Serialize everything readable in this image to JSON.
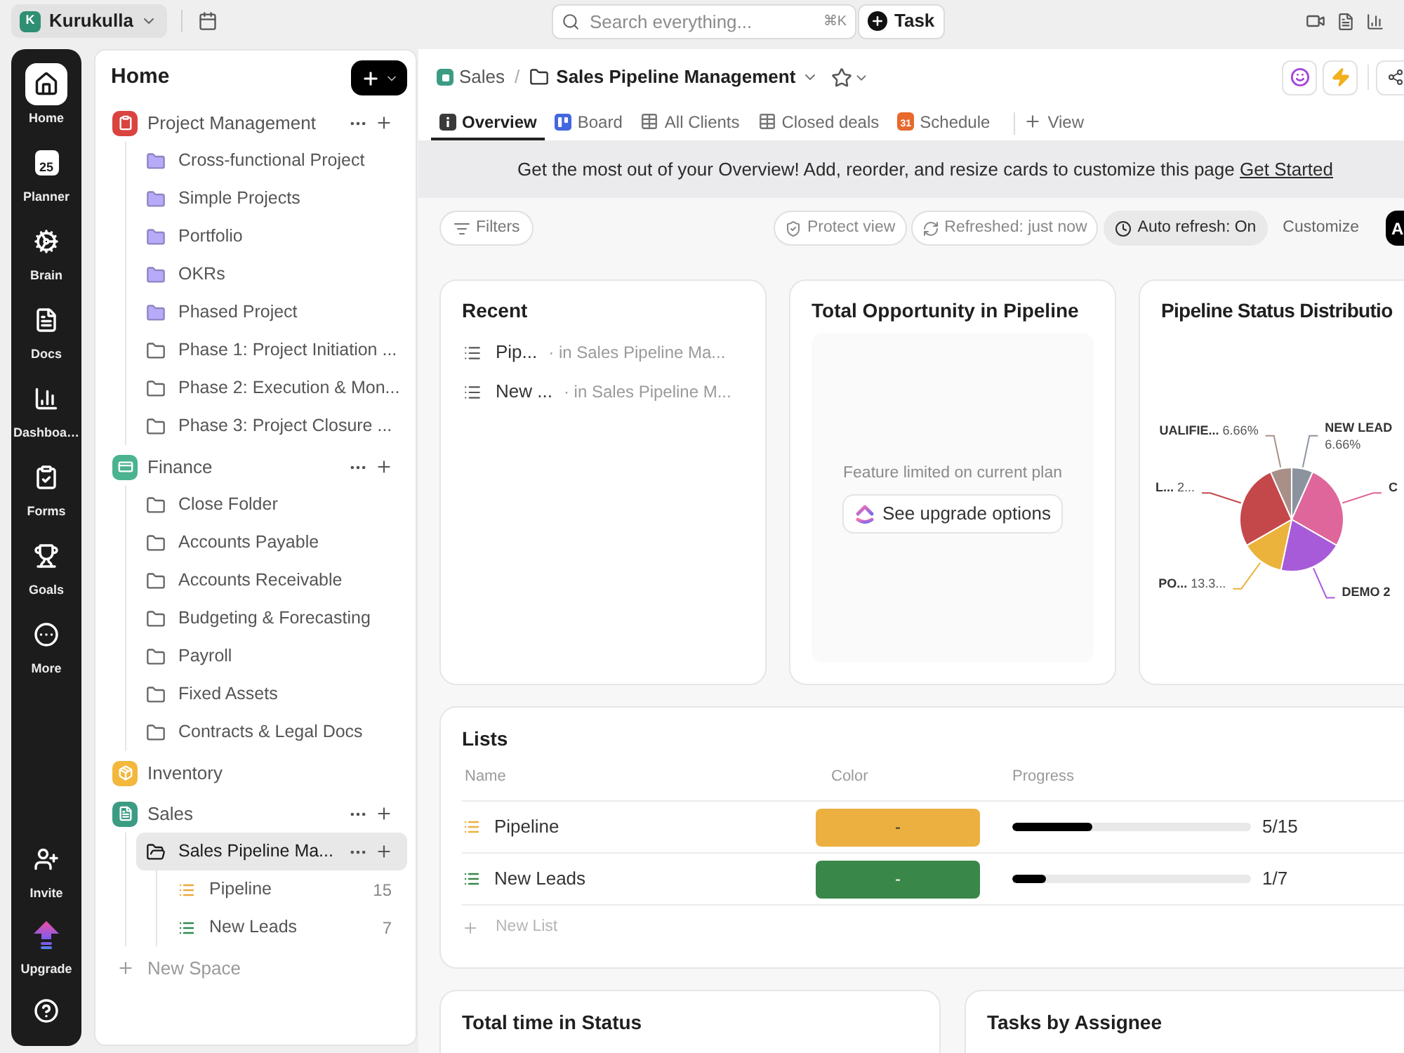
{
  "top_bar": {
    "workspace": {
      "avatar_letter": "K",
      "name": "Kurukulla"
    },
    "search": {
      "placeholder": "Search everything...",
      "shortcut": "⌘K"
    },
    "task_button": "Task"
  },
  "rail": {
    "items": [
      {
        "kind": "home",
        "label": "Home",
        "selected": true
      },
      {
        "kind": "planner",
        "label": "Planner",
        "icon_text": "25",
        "selected": false
      },
      {
        "kind": "brain",
        "label": "Brain",
        "selected": false
      },
      {
        "kind": "docs",
        "label": "Docs",
        "selected": false
      },
      {
        "kind": "dashboards",
        "label": "Dashboa…",
        "selected": false
      },
      {
        "kind": "forms",
        "label": "Forms",
        "selected": false
      },
      {
        "kind": "goals",
        "label": "Goals",
        "selected": false
      },
      {
        "kind": "more",
        "label": "More",
        "selected": false
      }
    ],
    "bottom_items": [
      {
        "kind": "invite",
        "label": "Invite"
      },
      {
        "kind": "upgrade",
        "label": "Upgrade"
      },
      {
        "kind": "help"
      }
    ]
  },
  "sidebar": {
    "title": "Home",
    "spaces": [
      {
        "name": "Project Management",
        "kind": "clipboard",
        "color": "#d9443f",
        "actions": true,
        "children": [
          {
            "name": "Cross-functional Project",
            "color": "#b7abf9",
            "selected": false
          },
          {
            "name": "Simple Projects",
            "color": "#b7abf9",
            "selected": false
          },
          {
            "name": "Portfolio",
            "color": "#b7abf9",
            "selected": false
          },
          {
            "name": "OKRs",
            "color": "#b7abf9",
            "selected": false
          },
          {
            "name": "Phased Project",
            "color": "#b7abf9",
            "selected": false
          },
          {
            "name": "Phase 1: Project Initiation ...",
            "selected": false
          },
          {
            "name": "Phase 2: Execution & Mon...",
            "selected": false
          },
          {
            "name": "Phase 3: Project Closure ...",
            "selected": false
          }
        ]
      },
      {
        "name": "Finance",
        "kind": "card",
        "color": "#4bb38f",
        "actions": true,
        "children": [
          {
            "name": "Close Folder",
            "selected": false
          },
          {
            "name": "Accounts Payable",
            "selected": false
          },
          {
            "name": "Accounts Receivable",
            "selected": false
          },
          {
            "name": "Budgeting & Forecasting",
            "selected": false
          },
          {
            "name": "Payroll",
            "selected": false
          },
          {
            "name": "Fixed Assets",
            "selected": false
          },
          {
            "name": "Contracts & Legal Docs",
            "selected": false
          }
        ]
      },
      {
        "name": "Inventory",
        "kind": "box",
        "color": "#f3b73c",
        "actions": false
      },
      {
        "name": "Sales",
        "kind": "sheet",
        "color": "#3b9c83",
        "actions": true,
        "children": [
          {
            "name": "Sales Pipeline Ma...",
            "selected": true,
            "children": [
              {
                "name": "Pipeline",
                "color": "#eea83a",
                "count": "15"
              },
              {
                "name": "New Leads",
                "color": "#2f8a4f",
                "count": "7"
              }
            ]
          }
        ]
      }
    ],
    "new_space": "New Space"
  },
  "breadcrumb": {
    "space": "Sales",
    "separator": "/",
    "page": "Sales Pipeline Management"
  },
  "tabs": [
    {
      "kind": "overview",
      "label": "Overview",
      "selected": true
    },
    {
      "kind": "board",
      "label": "Board",
      "selected": false
    },
    {
      "kind": "table",
      "label": "All Clients",
      "selected": false
    },
    {
      "kind": "table",
      "label": "Closed deals",
      "selected": false
    },
    {
      "kind": "calendar",
      "label": "Schedule",
      "icon_text": "31",
      "selected": false
    }
  ],
  "add_view": "View",
  "banner": {
    "text": "Get the most out of your Overview! Add, reorder, and resize cards to customize this page",
    "link": "Get Started"
  },
  "toolbar": {
    "filters": "Filters",
    "protect": "Protect view",
    "refreshed": "Refreshed: just now",
    "auto_refresh": {
      "label": "Auto refresh: On",
      "on": true
    },
    "customize": "Customize",
    "add_button": "A"
  },
  "recent": {
    "title": "Recent",
    "items": [
      {
        "name": "Pip...",
        "location": "· in Sales Pipeline Ma..."
      },
      {
        "name": "New ...",
        "location": "· in Sales Pipeline M..."
      }
    ]
  },
  "opportunity": {
    "title": "Total Opportunity in Pipeline",
    "message": "Feature limited on current plan",
    "button": "See upgrade options"
  },
  "status_distribution": {
    "chart_data": {
      "type": "pie",
      "title": "Pipeline Status Distributio",
      "categories": [
        "NEW LEAD",
        "C",
        "DEMO 2",
        "PO...",
        "L...",
        "UALIFIE..."
      ],
      "values": [
        6.66,
        26.66,
        20,
        13.33,
        26.66,
        6.66
      ],
      "colors": [
        "#8a939e",
        "#df669b",
        "#a75bd8",
        "#ebb33c",
        "#c4474a",
        "#a89088"
      ],
      "value_labels": [
        "6.66%",
        null,
        null,
        "13.3...",
        "2...",
        "6.66%"
      ]
    }
  },
  "lists": {
    "title": "Lists",
    "columns": [
      "Name",
      "Color",
      "Progress"
    ],
    "rows": [
      {
        "name": "Pipeline",
        "color": "#ebb040",
        "swatch_text": "-",
        "level": 0.333,
        "progress": "5/15"
      },
      {
        "name": "New Leads",
        "color": "#3a874a",
        "swatch_text": "-",
        "level": 0.143,
        "progress": "1/7"
      }
    ],
    "new_list": "New List"
  },
  "bottom_cards": [
    {
      "title": "Total time in Status"
    },
    {
      "title": "Tasks by Assignee"
    }
  ]
}
